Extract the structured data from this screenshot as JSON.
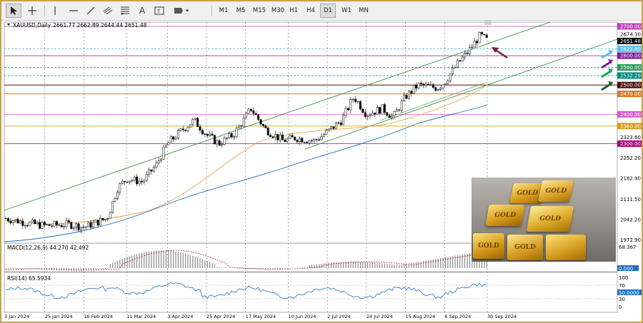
{
  "toolbar": {
    "tools": [
      "cursor-icon",
      "crosshair-icon",
      "vertical-line-icon",
      "horizontal-line-icon",
      "trendline-icon",
      "channel-icon",
      "fibonacci-icon",
      "text-icon",
      "label-icon",
      "shapes-icon"
    ],
    "text_tool": "A",
    "timeframes": [
      "M1",
      "M5",
      "M15",
      "M30",
      "H1",
      "H4",
      "D1",
      "W1",
      "MN"
    ],
    "active_timeframe": "D1"
  },
  "chart": {
    "header": "XAUUSD,Daily",
    "ohlc": "2661.77 2662.89 2644.44 2651.48",
    "symbol": "XAUUSD",
    "timeframe": "Daily",
    "last_price": "2651.48",
    "price_ticks": [
      "2674.30",
      "2323.60",
      "2252.20",
      "2182.90",
      "2111.50",
      "2042.20",
      "1972.90"
    ],
    "level_labels": [
      {
        "text": "2700.00",
        "color": "#c040c0"
      },
      {
        "text": "2623.60",
        "color": "#5bbcf0"
      },
      {
        "text": "2600.00",
        "color": "#7a1fa0"
      },
      {
        "text": "2560.00",
        "color": "#22a060"
      },
      {
        "text": "2532.29",
        "color": "#00897b"
      },
      {
        "text": "2500.00",
        "color": "#4a1010"
      },
      {
        "text": "2470.00",
        "color": "#e07820"
      },
      {
        "text": "2400.00",
        "color": "#d45ad4"
      },
      {
        "text": "2360.00",
        "color": "#d4a017"
      },
      {
        "text": "2300.00",
        "color": "#b00080"
      }
    ],
    "dates": [
      "3 Jan 2024",
      "25 Jan 2024",
      "16 Feb 2024",
      "11 Mar 2024",
      "3 Apr 2024",
      "25 Apr 2024",
      "17 May 2024",
      "10 Jun 2024",
      "2 Jul 2024",
      "24 Jul 2024",
      "15 Aug 2024",
      "6 Sep 2024",
      "30 Sep 2024"
    ],
    "image_labels": [
      "GOLD",
      "GOLD",
      "GOLD",
      "GOLD",
      "GOLD",
      "GOLD"
    ]
  },
  "macd": {
    "label": "MACD(12,26,9) 44.270 42.492",
    "ticks": [
      "68.367",
      "0.000"
    ]
  },
  "rsi": {
    "label": "RSI(14) 65.5934",
    "ticks": [
      "100",
      "70",
      "50.0000",
      "30",
      "0"
    ]
  },
  "colors": {
    "gold_frame": "#c8a24a",
    "candle": "#000000",
    "channel": "#2e8b2e",
    "ma_slow": "#1e6fc4",
    "ma_fast": "#f0a040",
    "macd": "#b22222",
    "rsi": "#1e6fc4"
  },
  "chart_data": {
    "type": "candlestick",
    "symbol": "XAUUSD",
    "timeframe": "Daily",
    "ylim": [
      1972.9,
      2700.0
    ],
    "close_path": [
      [
        "2024-01-03",
        2045
      ],
      [
        "2024-01-15",
        2030
      ],
      [
        "2024-01-25",
        2020
      ],
      [
        "2024-02-08",
        2025
      ],
      [
        "2024-02-16",
        2015
      ],
      [
        "2024-02-29",
        2045
      ],
      [
        "2024-03-06",
        2150
      ],
      [
        "2024-03-11",
        2180
      ],
      [
        "2024-03-20",
        2170
      ],
      [
        "2024-03-28",
        2230
      ],
      [
        "2024-04-03",
        2300
      ],
      [
        "2024-04-12",
        2350
      ],
      [
        "2024-04-18",
        2380
      ],
      [
        "2024-04-25",
        2330
      ],
      [
        "2024-05-02",
        2300
      ],
      [
        "2024-05-10",
        2330
      ],
      [
        "2024-05-17",
        2390
      ],
      [
        "2024-05-20",
        2420
      ],
      [
        "2024-05-28",
        2350
      ],
      [
        "2024-06-07",
        2310
      ],
      [
        "2024-06-14",
        2320
      ],
      [
        "2024-06-25",
        2310
      ],
      [
        "2024-07-02",
        2340
      ],
      [
        "2024-07-10",
        2380
      ],
      [
        "2024-07-17",
        2460
      ],
      [
        "2024-07-24",
        2400
      ],
      [
        "2024-08-02",
        2420
      ],
      [
        "2024-08-08",
        2390
      ],
      [
        "2024-08-15",
        2460
      ],
      [
        "2024-08-22",
        2500
      ],
      [
        "2024-09-02",
        2490
      ],
      [
        "2024-09-06",
        2510
      ],
      [
        "2024-09-13",
        2570
      ],
      [
        "2024-09-20",
        2620
      ],
      [
        "2024-09-26",
        2670
      ],
      [
        "2024-09-30",
        2651.48
      ]
    ],
    "horizontal_levels": [
      2700,
      2623.6,
      2600,
      2560,
      2532.29,
      2500,
      2470,
      2400,
      2360,
      2300
    ],
    "macd": {
      "line": 44.27,
      "signal": 42.492
    },
    "rsi": 65.5934
  }
}
